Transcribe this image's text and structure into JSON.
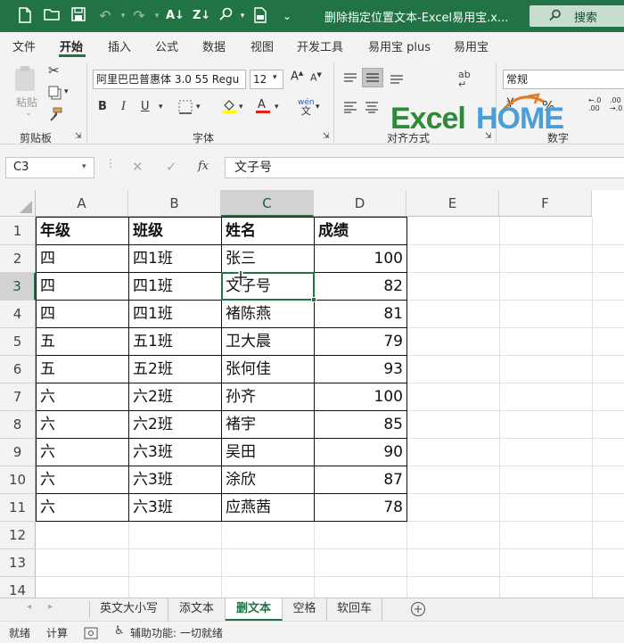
{
  "window": {
    "title": "删除指定位置文本-Excel易用宝.x...",
    "search_label": "搜索"
  },
  "menu": [
    "文件",
    "开始",
    "插入",
    "公式",
    "数据",
    "视图",
    "开发工具",
    "易用宝 plus",
    "易用宝"
  ],
  "ribbon": {
    "clipboard": {
      "paste": "粘贴",
      "group": "剪贴板"
    },
    "font": {
      "name": "阿里巴巴普惠体 3.0 55 Regu",
      "size": "12",
      "bold": "B",
      "italic": "I",
      "underline": "U",
      "font_color_letter": "A",
      "wen": "文",
      "group": "字体"
    },
    "alignment": {
      "group": "对齐方式",
      "wrap_icon": "ab"
    },
    "number": {
      "format": "常规",
      "percent": "%",
      "group": "数字"
    },
    "logo": {
      "text_a": "Excel",
      "text_b": "HOME"
    }
  },
  "formula_bar": {
    "name_box": "C3",
    "fx": "fx",
    "value": "文子号"
  },
  "grid": {
    "columns": [
      "A",
      "B",
      "C",
      "D",
      "E",
      "F"
    ],
    "selected_column": "C",
    "rows": [
      "1",
      "2",
      "3",
      "4",
      "5",
      "6",
      "7",
      "8",
      "9",
      "10",
      "11",
      "12",
      "13",
      "14"
    ],
    "selected_row": "3",
    "header_row": [
      "年级",
      "班级",
      "姓名",
      "成绩"
    ],
    "data": [
      [
        "四",
        "四1班",
        "张三",
        "100"
      ],
      [
        "四",
        "四1班",
        "文子号",
        "82"
      ],
      [
        "四",
        "四1班",
        "褚陈燕",
        "81"
      ],
      [
        "五",
        "五1班",
        "卫大晨",
        "79"
      ],
      [
        "五",
        "五2班",
        "张何佳",
        "93"
      ],
      [
        "六",
        "六2班",
        "孙齐",
        "100"
      ],
      [
        "六",
        "六2班",
        "褚宇",
        "85"
      ],
      [
        "六",
        "六3班",
        "吴田",
        "90"
      ],
      [
        "六",
        "六3班",
        "涂欣",
        "87"
      ],
      [
        "六",
        "六3班",
        "应燕茜",
        "78"
      ]
    ]
  },
  "sheet_tabs": {
    "tabs": [
      "英文大小写",
      "添文本",
      "删文本",
      "空格",
      "软回车"
    ],
    "active": "删文本"
  },
  "status_bar": {
    "ready": "就绪",
    "calc": "计算",
    "accessibility": "辅助功能: 一切就绪"
  },
  "colors": {
    "accent": "#217346"
  }
}
